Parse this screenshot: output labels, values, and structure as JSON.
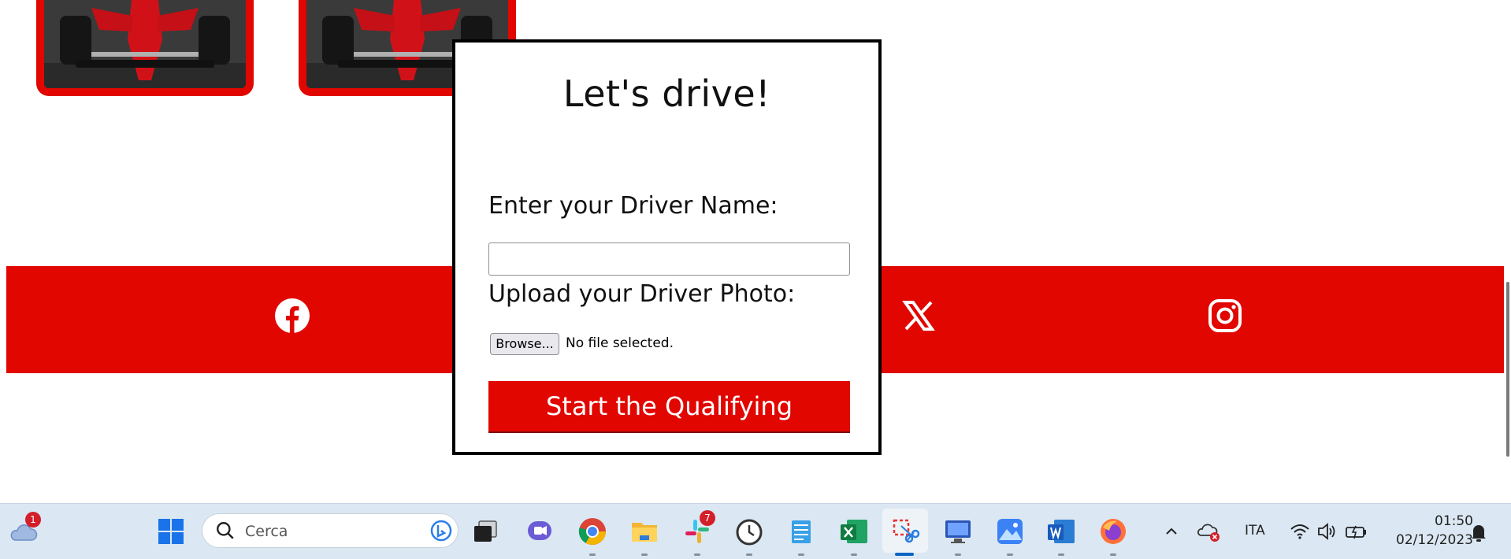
{
  "modal": {
    "title": "Let's drive!",
    "name_label": "Enter your Driver Name:",
    "name_value": "",
    "photo_label": "Upload your Driver Photo:",
    "browse_label": "Browse...",
    "file_status": "No file selected.",
    "start_button": "Start the Qualifying"
  },
  "social": {
    "icons": [
      "facebook-icon",
      "x-icon",
      "instagram-icon"
    ],
    "band_color": "#e10600"
  },
  "taskbar": {
    "weather_badge": "1",
    "search_placeholder": "Cerca",
    "slack_badge": "7",
    "language": "ITA",
    "time": "01:50",
    "date": "02/12/2023"
  },
  "colors": {
    "accent": "#e10600",
    "taskbar": "#dbe8f3"
  }
}
